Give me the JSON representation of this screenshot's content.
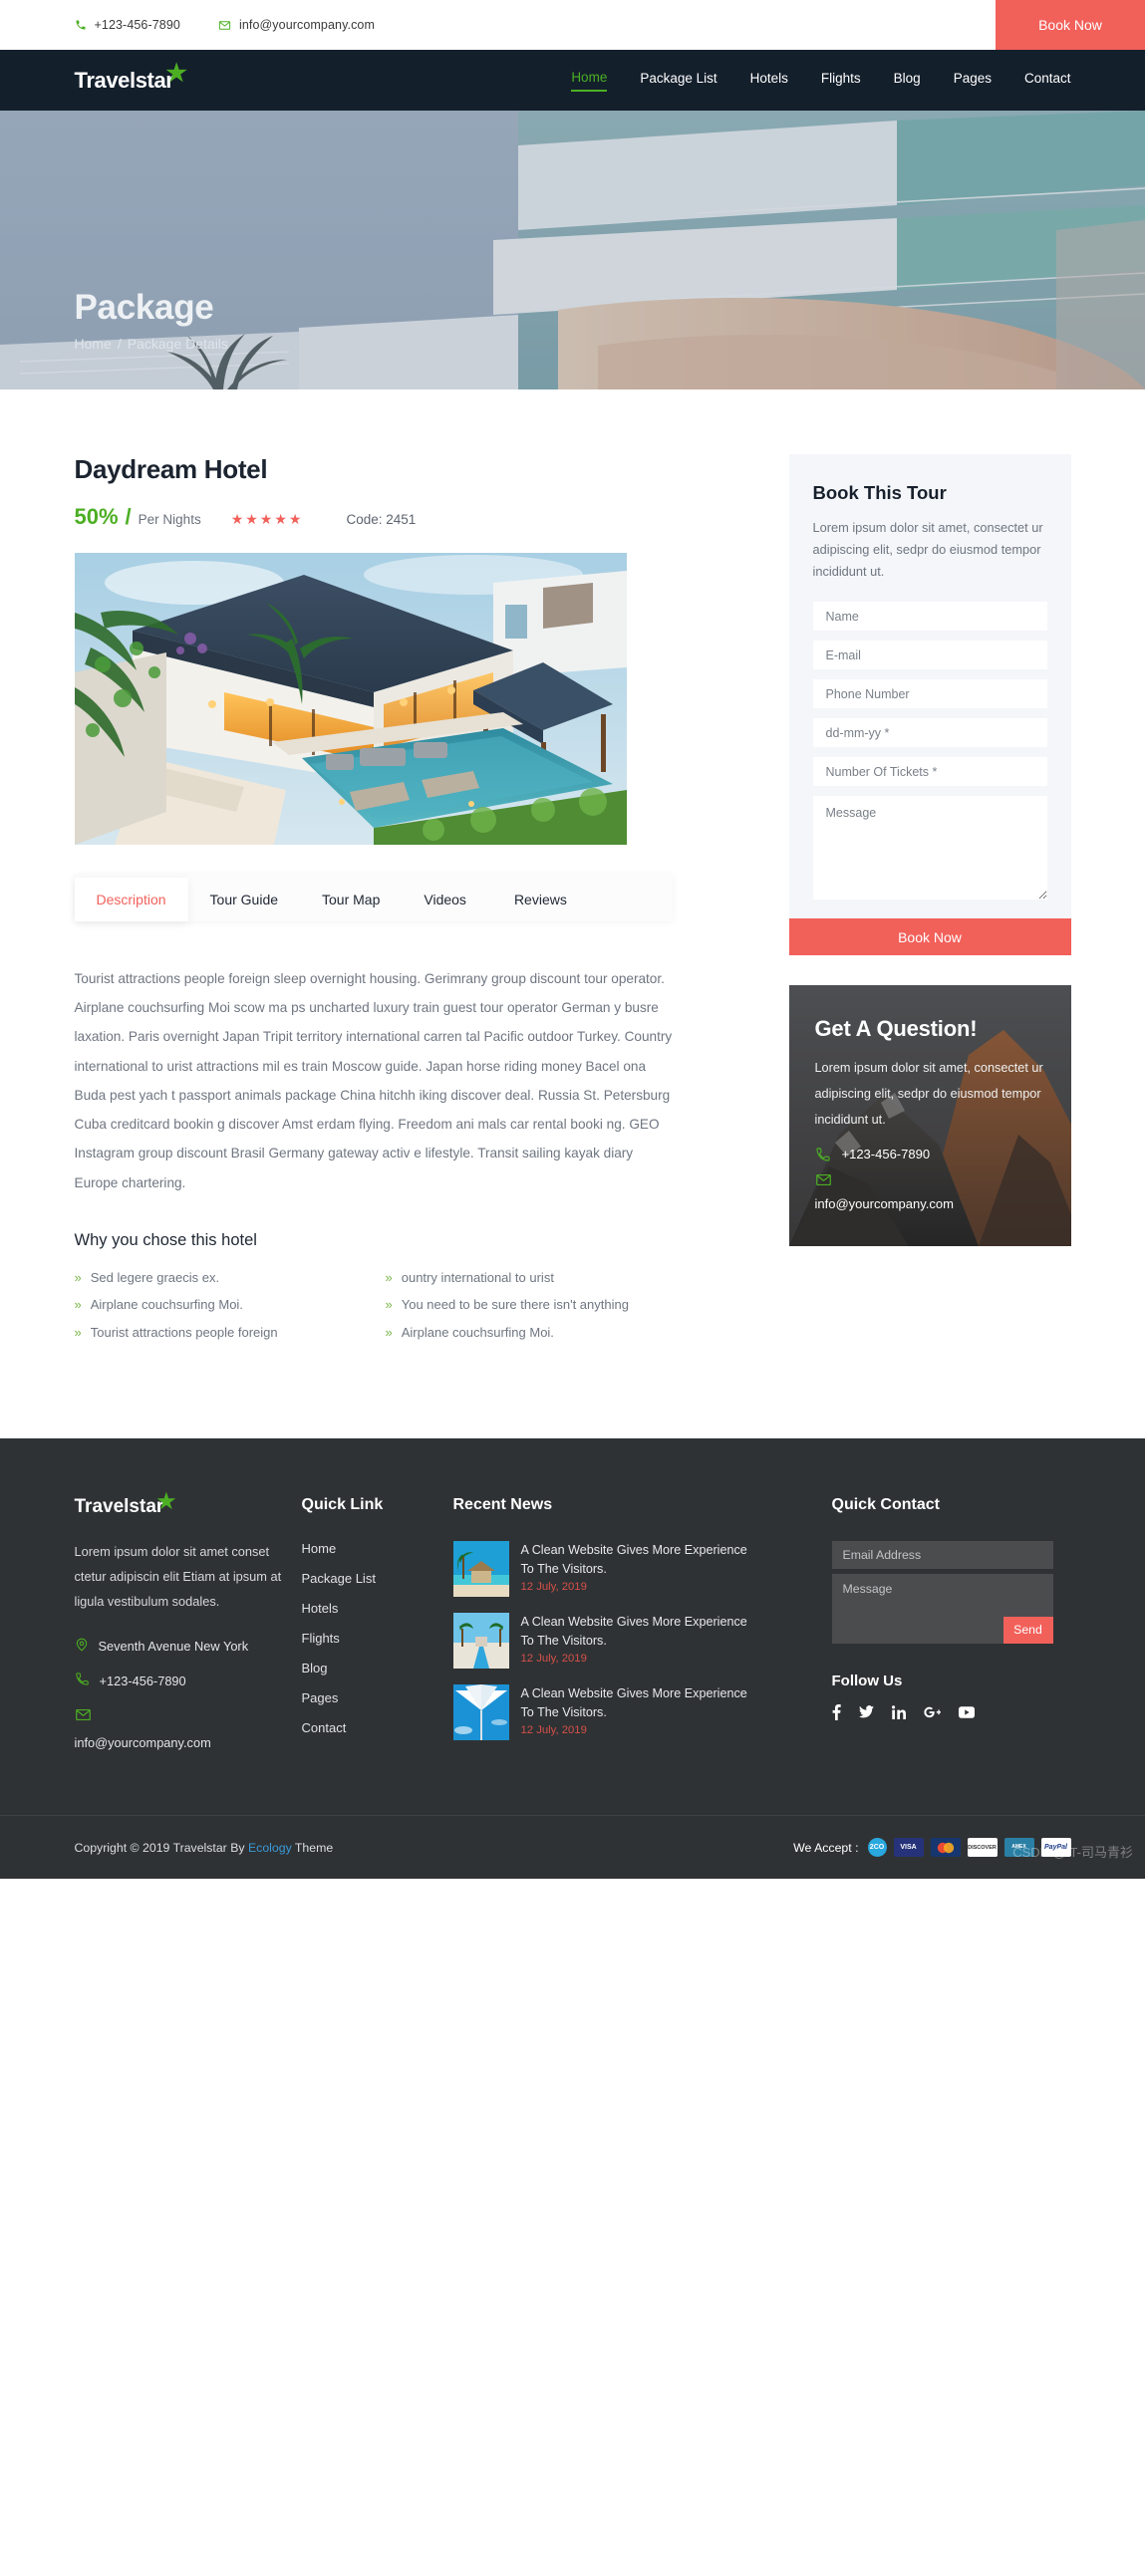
{
  "topbar": {
    "phone": "+123-456-7890",
    "email": "info@yourcompany.com",
    "book_now": "Book Now"
  },
  "nav": {
    "logo": "Travelstar",
    "links": [
      {
        "label": "Home",
        "active": true
      },
      {
        "label": "Package List",
        "active": false
      },
      {
        "label": "Hotels",
        "active": false
      },
      {
        "label": "Flights",
        "active": false
      },
      {
        "label": "Blog",
        "active": false
      },
      {
        "label": "Pages",
        "active": false
      },
      {
        "label": "Contact",
        "active": false
      }
    ]
  },
  "hero": {
    "title": "Package",
    "breadcrumb_home": "Home",
    "breadcrumb_sep": "/",
    "breadcrumb_current": "Package Details"
  },
  "detail": {
    "hotel_name": "Daydream Hotel",
    "discount": "50%",
    "slash": "/",
    "per_unit": "Per Nights",
    "stars": "★★★★★",
    "code": "Code: 2451",
    "tabs": [
      {
        "label": "Description",
        "active": true
      },
      {
        "label": "Tour Guide",
        "active": false
      },
      {
        "label": "Tour Map",
        "active": false
      },
      {
        "label": "Videos",
        "active": false
      },
      {
        "label": "Reviews",
        "active": false
      }
    ],
    "description": "Tourist attractions people foreign sleep overnight housing. Gerimrany group discount tour operator. Airplane couchsurfing Moi scow ma ps uncharted luxury train guest tour operator German y busre laxation. Paris overnight Japan Tripit territory international carren tal Pacific outdoor Turkey. Country international to urist attractions mil es train Moscow guide. Japan horse riding money Bacel ona Buda pest yach t passport animals package China hitchh iking discover deal. Russia St. Petersburg Cuba creditcard bookin g discover Amst erdam flying. Freedom ani mals car rental booki ng. GEO Instagram group discount Brasil Germany gateway activ e lifestyle. Transit sailing kayak diary Europe chartering.",
    "why_title": "Why you chose this hotel",
    "why_left": [
      "Sed legere graecis ex.",
      "Airplane couchsurfing Moi.",
      "Tourist attractions people foreign"
    ],
    "why_right": [
      "ountry international to urist",
      "You need to be sure there isn't anything",
      "Airplane couchsurfing Moi."
    ]
  },
  "book_form": {
    "title": "Book This Tour",
    "intro": "Lorem ipsum dolor sit amet, consectet ur adipiscing elit, sedpr do eiusmod tempor incididunt ut.",
    "name_placeholder": "Name",
    "email_placeholder": "E-mail",
    "phone_placeholder": "Phone Number",
    "date_placeholder": "dd-mm-yy *",
    "tickets_placeholder": "Number Of Tickets *",
    "message_placeholder": "Message",
    "submit": "Book Now"
  },
  "question_card": {
    "title": "Get A Question!",
    "body": "Lorem ipsum dolor sit amet, consectet ur adipiscing elit, sedpr do eiusmod tempor incididunt ut.",
    "phone": "+123-456-7890",
    "email": "info@yourcompany.com"
  },
  "footer": {
    "logo": "Travelstar",
    "about": "Lorem ipsum dolor sit amet conset ctetur adipiscin elit Etiam at ipsum at ligula vestibulum sodales.",
    "address": "Seventh Avenue New York",
    "phone": "+123-456-7890",
    "email": "info@yourcompany.com",
    "quick_link_head": "Quick Link",
    "quick_links": [
      "Home",
      "Package List",
      "Hotels",
      "Flights",
      "Blog",
      "Pages",
      "Contact"
    ],
    "recent_news_head": "Recent News",
    "recent_news": [
      {
        "title": "A Clean Website Gives More Experience To The Visitors.",
        "date": "12 July, 2019"
      },
      {
        "title": "A Clean Website Gives More Experience To The Visitors.",
        "date": "12 July, 2019"
      },
      {
        "title": "A Clean Website Gives More Experience To The Visitors.",
        "date": "12 July, 2019"
      }
    ],
    "quick_contact_head": "Quick Contact",
    "email_placeholder": "Email Address",
    "message_placeholder": "Message",
    "send_label": "Send",
    "follow_head": "Follow Us",
    "socials": [
      "facebook-icon",
      "twitter-icon",
      "linkedin-icon",
      "google-plus-icon",
      "youtube-icon"
    ]
  },
  "copyright": {
    "before": "Copyright © 2019 Travelstar By ",
    "link": "Ecology",
    "after": " Theme",
    "accept_label": "We Accept :",
    "payments": [
      "2CO",
      "VISA",
      "MC",
      "DISCOVER",
      "AMEX",
      "PayPal"
    ],
    "watermark": "CSDN @IT-司马青衫"
  },
  "colors": {
    "accent_red": "#f2605a",
    "accent_green": "#4caf23",
    "nav_dark": "#141f2c",
    "footer_dark": "#2f3234"
  }
}
